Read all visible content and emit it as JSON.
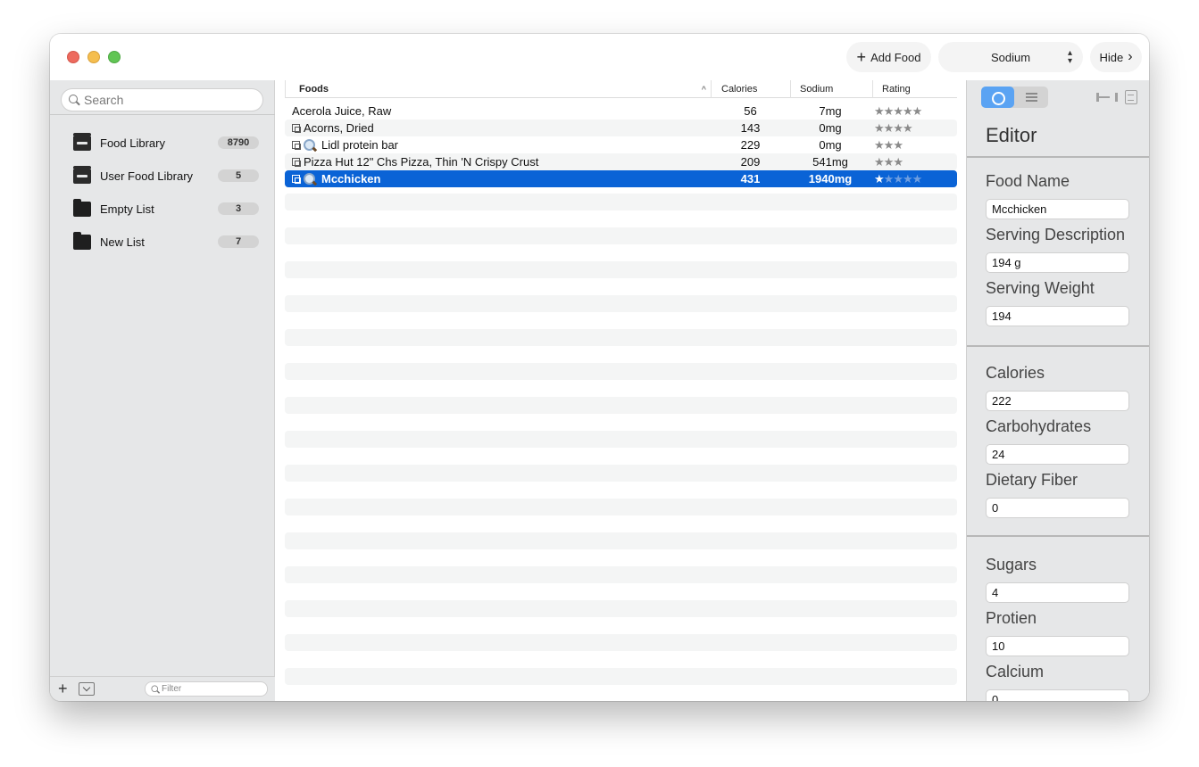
{
  "toolbar": {
    "add_food_label": "Add Food",
    "nutrient_select": "Sodium",
    "hide_label": "Hide"
  },
  "sidebar": {
    "search_placeholder": "Search",
    "items": [
      {
        "label": "Food Library",
        "count": "8790",
        "icon": "tray-icon"
      },
      {
        "label": "User Food Library",
        "count": "5",
        "icon": "tray-icon"
      },
      {
        "label": "Empty List",
        "count": "3",
        "icon": "folder-icon"
      },
      {
        "label": "New List",
        "count": "7",
        "icon": "folder-icon"
      }
    ],
    "filter_placeholder": "Filter"
  },
  "table": {
    "columns": {
      "foods": "Foods",
      "calories": "Calories",
      "sodium": "Sodium",
      "rating": "Rating"
    },
    "rows": [
      {
        "name": "Acerola Juice, Raw",
        "calories": "56",
        "sodium": "7mg",
        "rating": 5,
        "copy_icon": false,
        "search_icon": false
      },
      {
        "name": "Acorns, Dried",
        "calories": "143",
        "sodium": "0mg",
        "rating": 4,
        "copy_icon": true,
        "search_icon": false
      },
      {
        "name": "Lidl protein bar",
        "calories": "229",
        "sodium": "0mg",
        "rating": 3,
        "copy_icon": true,
        "search_icon": true
      },
      {
        "name": "Pizza Hut 12\" Chs Pizza, Thin 'N Crispy Crust",
        "calories": "209",
        "sodium": "541mg",
        "rating": 3,
        "copy_icon": true,
        "search_icon": false
      },
      {
        "name": "Mcchicken",
        "calories": "431",
        "sodium": "1940mg",
        "rating": 1,
        "copy_icon": true,
        "search_icon": true,
        "selected": true
      }
    ]
  },
  "editor": {
    "title": "Editor",
    "fields": [
      {
        "label": "Food Name",
        "value": "Mcchicken"
      },
      {
        "label": "Serving Description",
        "value": "194 g"
      },
      {
        "label": "Serving Weight",
        "value": "194"
      },
      {
        "label": "Calories",
        "value": "222"
      },
      {
        "label": "Carbohydrates",
        "value": "24"
      },
      {
        "label": "Dietary Fiber",
        "value": "0"
      },
      {
        "label": "Sugars",
        "value": "4"
      },
      {
        "label": "Protien",
        "value": "10"
      },
      {
        "label": "Calcium",
        "value": "0"
      }
    ]
  },
  "colors": {
    "selection": "#0a63d6",
    "segment_active": "#5aa3f3"
  }
}
